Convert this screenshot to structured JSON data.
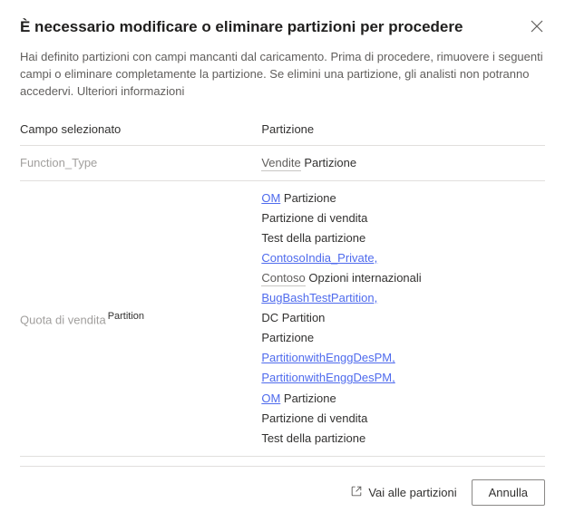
{
  "dialog": {
    "title": "È necessario modificare o eliminare partizioni per procedere",
    "description": "Hai definito partizioni con campi mancanti dal caricamento. Prima di procedere, rimuovere i seguenti campi o eliminare completamente la partizione. Se elimini una partizione, gli analisti non potranno accedervi. Ulteriori informazioni",
    "col1": "Campo selezionato",
    "col2": "Partizione"
  },
  "rows": [
    {
      "campo": "Function_Type",
      "campo_suffix": "",
      "items": [
        {
          "pre": "Vendite",
          "pre_style": "muted-u",
          "suf": "Partizione"
        }
      ]
    },
    {
      "campo": "Quota di vendita",
      "campo_suffix": "Partition",
      "items": [
        {
          "pre": "OM",
          "pre_style": "link",
          "suf": "Partizione"
        },
        {
          "text": "Partizione di vendita",
          "style": "plain"
        },
        {
          "text": "Test della partizione",
          "style": "plain"
        },
        {
          "text": "ContosoIndia_Private,",
          "style": "link"
        },
        {
          "pre": "Contoso",
          "pre_style": "muted-u",
          "suf": "Opzioni internazionali"
        },
        {
          "text": "BugBashTestPartition,",
          "style": "link"
        },
        {
          "text": " ",
          "style": "plain"
        },
        {
          "pre": "DC Partition",
          "pre_style": "plain",
          "suf": ""
        },
        {
          "text": "Partizione",
          "style": "plain"
        },
        {
          "text": "PartitionwithEnggDesPM,",
          "style": "link"
        },
        {
          "text": "PartitionwithEnggDesPM,",
          "style": "link"
        },
        {
          "pre": "OM",
          "pre_style": "link",
          "suf": "Partizione"
        },
        {
          "text": "Partizione di vendita",
          "style": "plain"
        },
        {
          "text": "Test della partizione",
          "style": "plain"
        }
      ]
    }
  ],
  "footer": {
    "goto": "Vai alle partizioni",
    "cancel": "Annulla"
  }
}
